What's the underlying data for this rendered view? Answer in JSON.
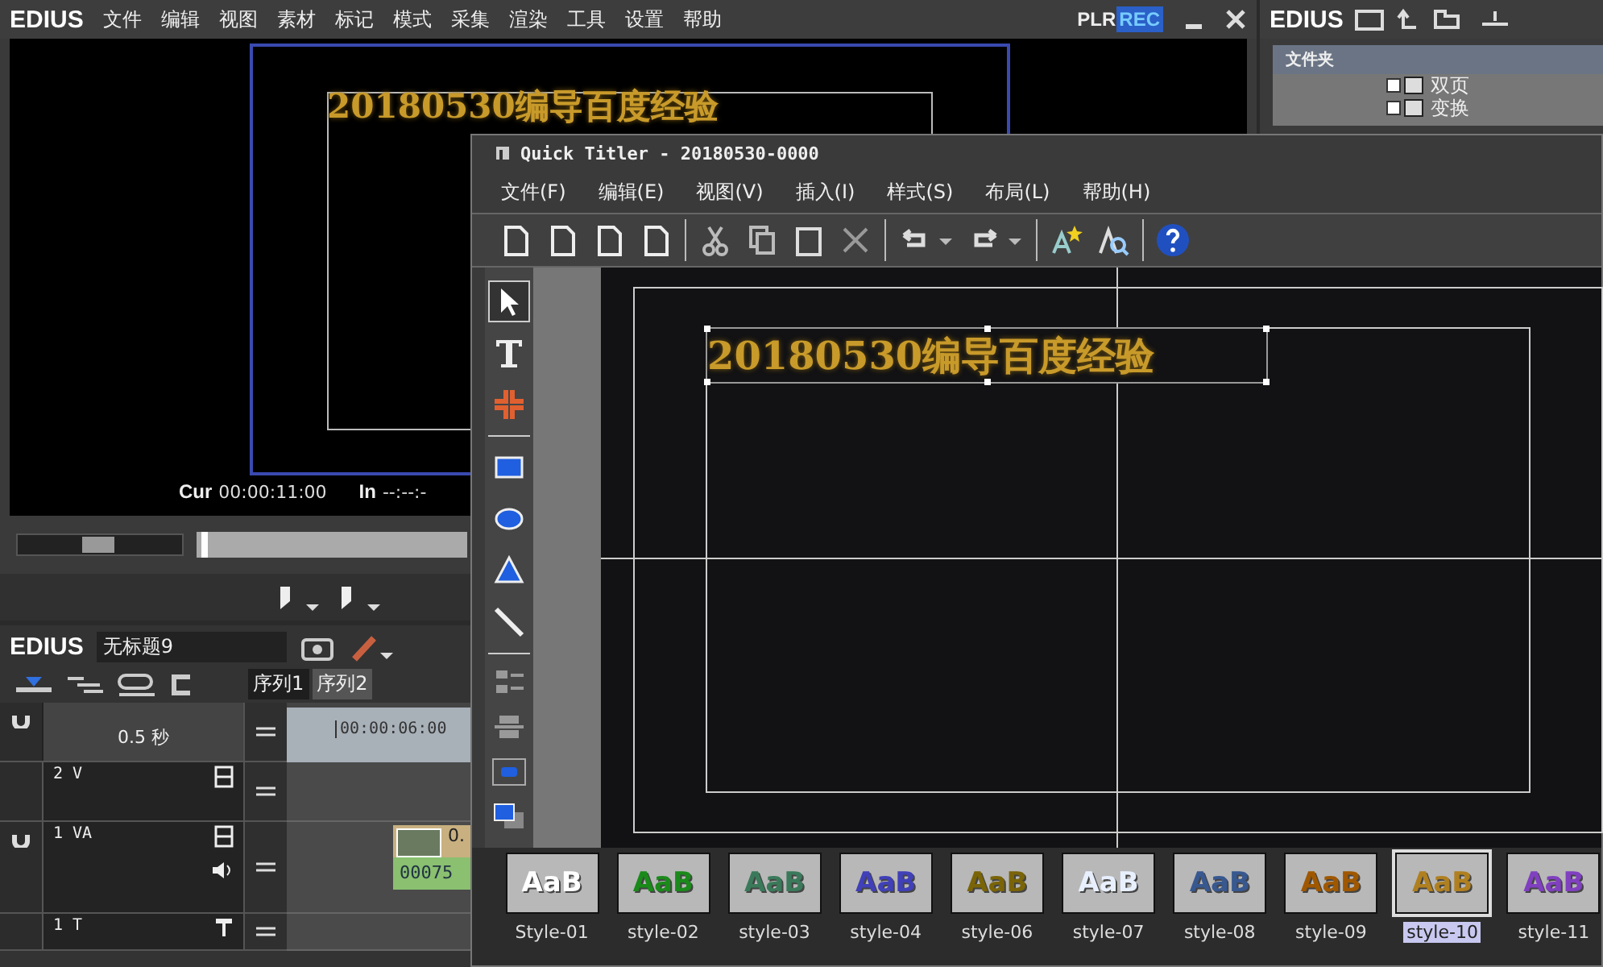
{
  "main_menu": {
    "logo": "EDIUS",
    "items": [
      "文件",
      "编辑",
      "视图",
      "素材",
      "标记",
      "模式",
      "采集",
      "渲染",
      "工具",
      "设置",
      "帮助"
    ]
  },
  "player": {
    "shuttle": {
      "level": 0.5
    },
    "position": {
      "level": 0.02
    },
    "plr": "PLR",
    "rec": "REC",
    "preview_text": "20180530编导百度经验",
    "cur_label": "Cur",
    "cur_time": "00:00:11:00",
    "in_label": "In",
    "in_time": "--:--:-"
  },
  "bin": {
    "logo": "EDIUS",
    "header": "文件夹",
    "items": [
      {
        "label": "双页"
      },
      {
        "label": "变换"
      }
    ]
  },
  "timeline": {
    "logo": "EDIUS",
    "project": "无标题9",
    "sequences": [
      {
        "label": "序列1",
        "selected": true
      },
      {
        "label": "序列2",
        "selected": false
      }
    ],
    "zoom": "0.5 秒",
    "ruler_time": "00:00:06:00",
    "clip_label": "00075",
    "clip_title": "0.",
    "tracks": [
      {
        "name": "2 V",
        "kind": "video"
      },
      {
        "name": "1 VA",
        "kind": "av"
      },
      {
        "name": "1 T",
        "kind": "title"
      }
    ]
  },
  "titler": {
    "title": "Quick Titler - 20180530-0000",
    "menu": [
      "文件(F)",
      "编辑(E)",
      "视图(V)",
      "插入(I)",
      "样式(S)",
      "布局(L)",
      "帮助(H)"
    ],
    "canvas_text": "20180530编导百度经验",
    "tools": [
      {
        "kind": "arrow",
        "selected": true
      },
      {
        "kind": "text",
        "selected": false
      },
      {
        "kind": "cross",
        "selected": false
      },
      {
        "kind": "rect",
        "selected": false
      },
      {
        "kind": "ellipse",
        "selected": false
      },
      {
        "kind": "triangle",
        "selected": false
      },
      {
        "kind": "line",
        "selected": false
      }
    ],
    "styles": [
      {
        "label": "Style-01",
        "sample": "AaB",
        "color": "#ffffff",
        "selected": false
      },
      {
        "label": "style-02",
        "sample": "AaB",
        "color": "#1a8a1a",
        "selected": false
      },
      {
        "label": "style-03",
        "sample": "AaB",
        "color": "#3a7a5a",
        "selected": false
      },
      {
        "label": "style-04",
        "sample": "AaB",
        "color": "#4040b8",
        "selected": false
      },
      {
        "label": "style-06",
        "sample": "AaB",
        "color": "#7a6408",
        "selected": false
      },
      {
        "label": "style-07",
        "sample": "AaB",
        "color": "#e8f0ff",
        "selected": false
      },
      {
        "label": "style-08",
        "sample": "AaB",
        "color": "#385890",
        "selected": false
      },
      {
        "label": "style-09",
        "sample": "AaB",
        "color": "#a05800",
        "selected": false
      },
      {
        "label": "style-10",
        "sample": "AaB",
        "color": "#b08020",
        "selected": true
      },
      {
        "label": "style-11",
        "sample": "AaB",
        "color": "#8040c0",
        "selected": false
      }
    ]
  }
}
